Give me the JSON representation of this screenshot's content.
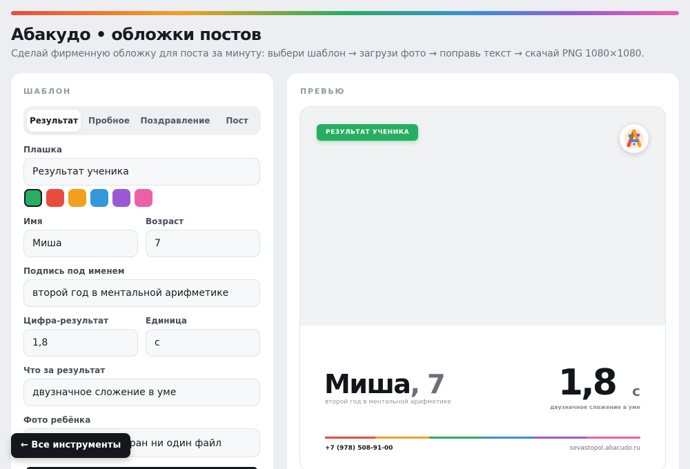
{
  "header": {
    "title": "Абакудо • обложки постов",
    "subtitle": "Сделай фирменную обложку для поста за минуту: выбери шаблон → загрузи фото → поправь текст → скачай PNG 1080×1080."
  },
  "form": {
    "section_label": "ШАБЛОН",
    "tabs": [
      {
        "label": "Результат",
        "active": true
      },
      {
        "label": "Пробное",
        "active": false
      },
      {
        "label": "Поздравление",
        "active": false
      },
      {
        "label": "Пост",
        "active": false
      }
    ],
    "badge_label": "Плашка",
    "badge_value": "Результат ученика",
    "swatches": [
      {
        "color": "#27ae60",
        "selected": true
      },
      {
        "color": "#ea4c3c",
        "selected": false
      },
      {
        "color": "#f4a01e",
        "selected": false
      },
      {
        "color": "#3498db",
        "selected": false
      },
      {
        "color": "#9b59d6",
        "selected": false
      },
      {
        "color": "#ee5fa8",
        "selected": false
      }
    ],
    "name_label": "Имя",
    "name_value": "Миша",
    "age_label": "Возраст",
    "age_value": "7",
    "caption_label": "Подпись под именем",
    "caption_value": "второй год в ментальной арифметике",
    "result_label": "Цифра-результат",
    "result_value": "1,8",
    "unit_label": "Единица",
    "unit_value": "с",
    "what_label": "Что за результат",
    "what_value": "двузначное сложение в уме",
    "photo_label": "Фото ребёнка",
    "file_text": "ыбран ни один файл"
  },
  "preview": {
    "section_label": "ПРЕВЬЮ",
    "badge": "РЕЗУЛЬТАТ УЧЕНИКА",
    "name": "Миша",
    "age_text": ", 7",
    "caption": "второй год в ментальной арифметике",
    "result": "1,8",
    "unit": "с",
    "what": "двузначное сложение в уме",
    "phone": "+7 (978) 508-91-00",
    "site": "sevastopol.abacudo.ru"
  },
  "back_button": "← Все инструменты",
  "colors": {
    "accent": "#27ae60",
    "dark": "#16171c"
  }
}
